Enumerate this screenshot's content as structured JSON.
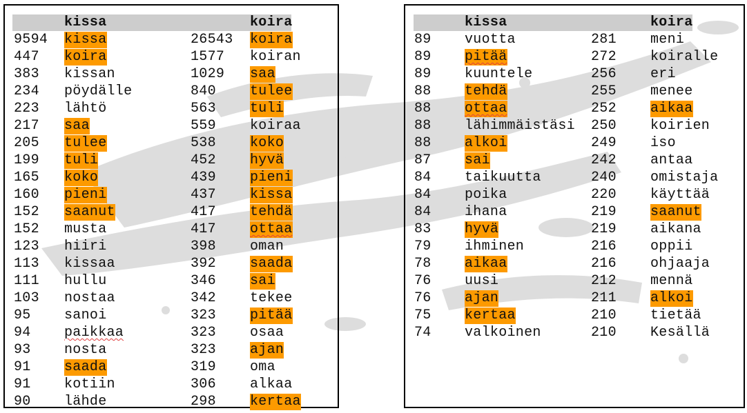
{
  "colors": {
    "highlight": "#fd9a00",
    "header_band": "#cdcdcd",
    "border": "#000000"
  },
  "tables": [
    {
      "headers": [
        "",
        "kissa",
        "",
        "koira"
      ],
      "rows": [
        {
          "n1": "9594",
          "w1": "kissa",
          "h1": true,
          "n2": "26543",
          "w2": "koira",
          "h2": true
        },
        {
          "n1": "447",
          "w1": "koira",
          "h1": true,
          "n2": "1577",
          "w2": "koiran",
          "h2": false
        },
        {
          "n1": "383",
          "w1": "kissan",
          "h1": false,
          "n2": "1029",
          "w2": "saa",
          "h2": true
        },
        {
          "n1": "234",
          "w1": "pöydälle",
          "h1": false,
          "n2": "840",
          "w2": "tulee",
          "h2": true
        },
        {
          "n1": "223",
          "w1": "lähtö",
          "h1": false,
          "n2": "563",
          "w2": "tuli",
          "h2": true
        },
        {
          "n1": "217",
          "w1": "saa",
          "h1": true,
          "n2": "559",
          "w2": "koiraa",
          "h2": false
        },
        {
          "n1": "205",
          "w1": "tulee",
          "h1": true,
          "n2": "538",
          "w2": "koko",
          "h2": true
        },
        {
          "n1": "199",
          "w1": "tuli",
          "h1": true,
          "n2": "452",
          "w2": "hyvä",
          "h2": true
        },
        {
          "n1": "165",
          "w1": "koko",
          "h1": true,
          "n2": "439",
          "w2": "pieni",
          "h2": true
        },
        {
          "n1": "160",
          "w1": "pieni",
          "h1": true,
          "n2": "437",
          "w2": "kissa",
          "h2": true
        },
        {
          "n1": "152",
          "w1": "saanut",
          "h1": true,
          "n2": "417",
          "w2": "tehdä",
          "h2": true
        },
        {
          "n1": "152",
          "w1": "musta",
          "h1": false,
          "n2": "417",
          "w2": "ottaa",
          "h2": true,
          "wv2": true
        },
        {
          "n1": "123",
          "w1": "hiiri",
          "h1": false,
          "n2": "398",
          "w2": "oman",
          "h2": false
        },
        {
          "n1": "113",
          "w1": "kissaa",
          "h1": false,
          "n2": "392",
          "w2": "saada",
          "h2": true
        },
        {
          "n1": "111",
          "w1": "hullu",
          "h1": false,
          "n2": "346",
          "w2": "sai",
          "h2": true
        },
        {
          "n1": "103",
          "w1": "nostaa",
          "h1": false,
          "n2": "342",
          "w2": "tekee",
          "h2": false
        },
        {
          "n1": "95",
          "w1": "sanoi",
          "h1": false,
          "n2": "323",
          "w2": "pitää",
          "h2": true
        },
        {
          "n1": "94",
          "w1": "paikkaa",
          "h1": false,
          "wv1": true,
          "n2": "323",
          "w2": "osaa",
          "h2": false
        },
        {
          "n1": "93",
          "w1": "nosta",
          "h1": false,
          "n2": "323",
          "w2": "ajan",
          "h2": true
        },
        {
          "n1": "91",
          "w1": "saada",
          "h1": true,
          "n2": "319",
          "w2": "oma",
          "h2": false
        },
        {
          "n1": "91",
          "w1": "kotiin",
          "h1": false,
          "n2": "306",
          "w2": "alkaa",
          "h2": false
        },
        {
          "n1": "90",
          "w1": "lähde",
          "h1": false,
          "n2": "298",
          "w2": "kertaa",
          "h2": true
        }
      ]
    },
    {
      "headers": [
        "",
        "kissa",
        "",
        "koira"
      ],
      "rows": [
        {
          "n1": "89",
          "w1": "vuotta",
          "h1": false,
          "n2": "281",
          "w2": "meni",
          "h2": false
        },
        {
          "n1": "89",
          "w1": "pitää",
          "h1": true,
          "wv1": true,
          "n2": "272",
          "w2": "koiralle",
          "h2": false
        },
        {
          "n1": "89",
          "w1": "kuuntele",
          "h1": false,
          "n2": "256",
          "w2": "eri",
          "h2": false
        },
        {
          "n1": "88",
          "w1": "tehdä",
          "h1": true,
          "n2": "255",
          "w2": "menee",
          "h2": false
        },
        {
          "n1": "88",
          "w1": "ottaa",
          "h1": true,
          "wv1": true,
          "n2": "252",
          "w2": "aikaa",
          "h2": true
        },
        {
          "n1": "88",
          "w1": "lähimmäistäsi",
          "h1": false,
          "n2": "250",
          "w2": "koirien",
          "h2": false
        },
        {
          "n1": "88",
          "w1": "alkoi",
          "h1": true,
          "n2": "249",
          "w2": "iso",
          "h2": false
        },
        {
          "n1": "87",
          "w1": "sai",
          "h1": true,
          "n2": "242",
          "w2": "antaa",
          "h2": false
        },
        {
          "n1": "84",
          "w1": "taikuutta",
          "h1": false,
          "n2": "240",
          "w2": "omistaja",
          "h2": false
        },
        {
          "n1": "84",
          "w1": "poika",
          "h1": false,
          "n2": "220",
          "w2": "käyttää",
          "h2": false
        },
        {
          "n1": "84",
          "w1": "ihana",
          "h1": false,
          "n2": "219",
          "w2": "saanut",
          "h2": true
        },
        {
          "n1": "83",
          "w1": "hyvä",
          "h1": true,
          "n2": "219",
          "w2": "aikana",
          "h2": false
        },
        {
          "n1": "79",
          "w1": "ihminen",
          "h1": false,
          "n2": "216",
          "w2": "oppii",
          "h2": false
        },
        {
          "n1": "78",
          "w1": "aikaa",
          "h1": true,
          "n2": "216",
          "w2": "ohjaaja",
          "h2": false
        },
        {
          "n1": "76",
          "w1": "uusi",
          "h1": false,
          "n2": "212",
          "w2": "mennä",
          "h2": false
        },
        {
          "n1": "76",
          "w1": "ajan",
          "h1": true,
          "n2": "211",
          "w2": "alkoi",
          "h2": true
        },
        {
          "n1": "75",
          "w1": "kertaa",
          "h1": true,
          "n2": "210",
          "w2": "tietää",
          "h2": false
        },
        {
          "n1": "74",
          "w1": "valkoinen",
          "h1": false,
          "n2": "210",
          "w2": "Kesällä",
          "h2": false
        }
      ]
    }
  ]
}
